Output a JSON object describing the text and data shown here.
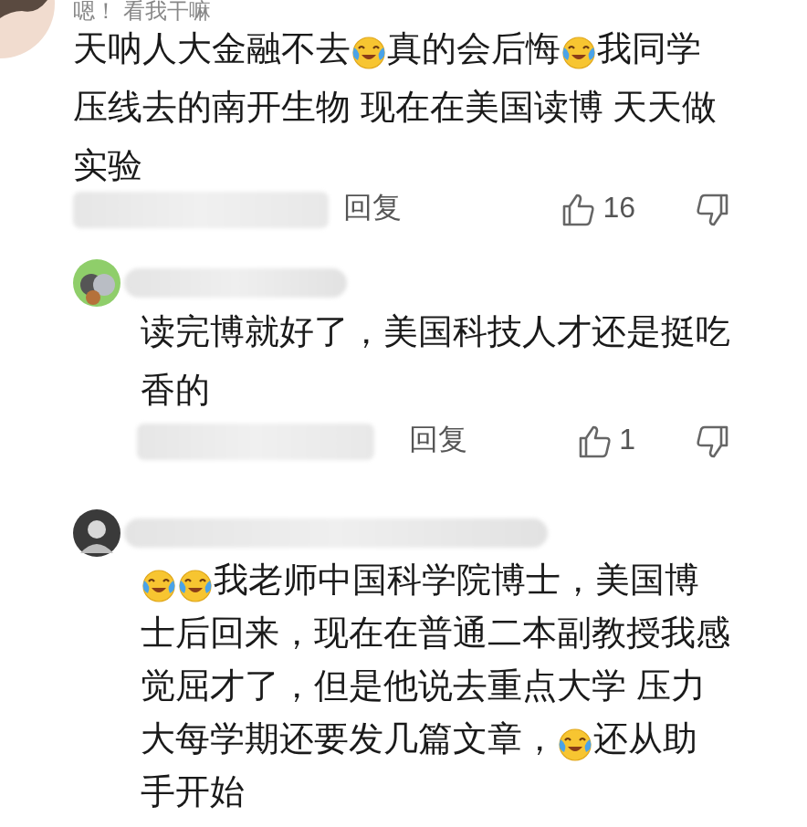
{
  "comments": [
    {
      "author": "嗯！ 看我干嘛",
      "lines": [
        [
          {
            "kind": "text",
            "text": "天呐人大金融不去"
          },
          {
            "kind": "emoji"
          },
          {
            "kind": "text",
            "text": "真的会后悔"
          },
          {
            "kind": "emoji"
          },
          {
            "kind": "text",
            "text": "我同学"
          }
        ],
        [
          {
            "kind": "text",
            "text": "压线去的南开生物 现在在美国读博 天天做"
          }
        ],
        [
          {
            "kind": "text",
            "text": "实验"
          }
        ]
      ],
      "reply_label": "回复",
      "likes": "16"
    },
    {
      "lines": [
        [
          {
            "kind": "text",
            "text": "读完博就好了，美国科技人才还是挺吃"
          }
        ],
        [
          {
            "kind": "text",
            "text": "香的"
          }
        ]
      ],
      "reply_label": "回复",
      "likes": "1"
    },
    {
      "lines": [
        [
          {
            "kind": "emoji"
          },
          {
            "kind": "emoji"
          },
          {
            "kind": "text",
            "text": "我老师中国科学院博士，美国博"
          }
        ],
        [
          {
            "kind": "text",
            "text": "士后回来，现在在普通二本副教授我感"
          }
        ],
        [
          {
            "kind": "text",
            "text": "觉屈才了，但是他说去重点大学 压力"
          }
        ],
        [
          {
            "kind": "text",
            "text": "大每学期还要发几篇文章，"
          },
          {
            "kind": "emoji"
          },
          {
            "kind": "text",
            "text": "还从助"
          }
        ],
        [
          {
            "kind": "text",
            "text": "手开始"
          }
        ]
      ]
    }
  ]
}
